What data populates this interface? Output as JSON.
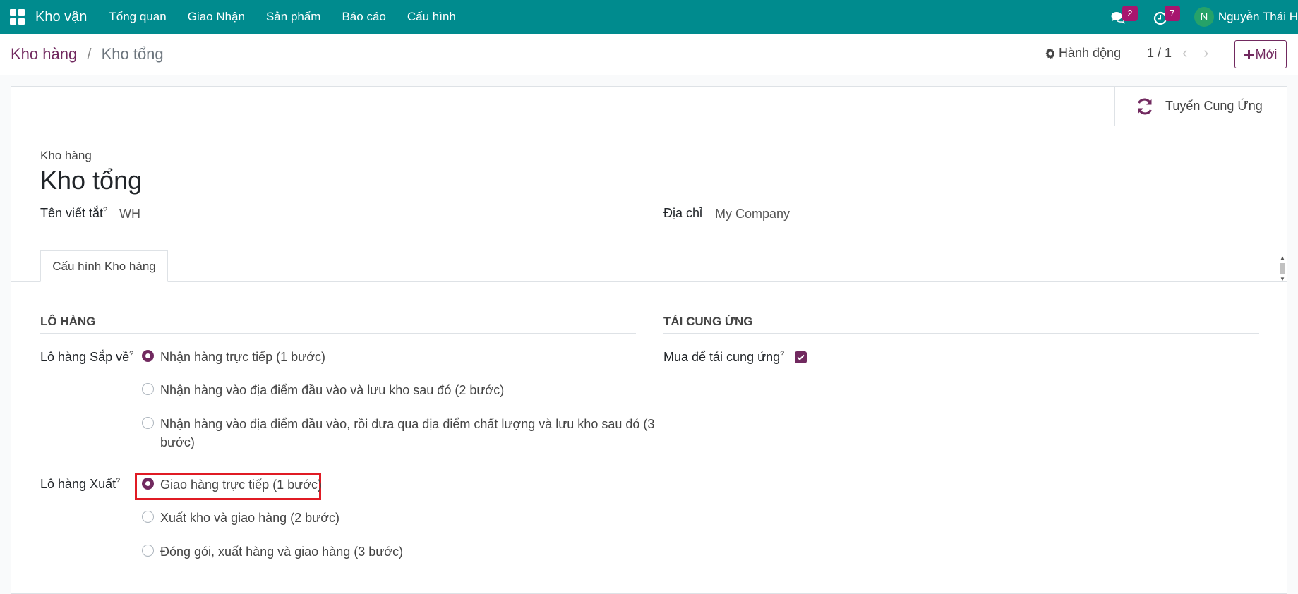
{
  "navbar": {
    "app_name": "Kho vận",
    "menu": [
      "Tổng quan",
      "Giao Nhận",
      "Sản phẩm",
      "Báo cáo",
      "Cấu hình"
    ],
    "messages_count": "2",
    "activities_count": "7",
    "avatar_initial": "N",
    "username": "Nguyễn Thái H",
    "bg_color": "#008b8e"
  },
  "control": {
    "breadcrumb_parent": "Kho hàng",
    "breadcrumb_sep": "/",
    "breadcrumb_current": "Kho tổng",
    "action_label": "Hành động",
    "pager": "1 / 1",
    "new_label": "Mới"
  },
  "smart_button": {
    "label": "Tuyến Cung Ứng"
  },
  "form": {
    "top_label": "Kho hàng",
    "title": "Kho tổng",
    "short_name_label": "Tên viết tắt",
    "short_name_value": "WH",
    "address_label": "Địa chỉ",
    "address_value": "My Company",
    "tab_label": "Cấu hình Kho hàng",
    "help_mark": "?"
  },
  "shipments": {
    "section_title": "LÔ HÀNG",
    "incoming_label": "Lô hàng Sắp về",
    "incoming_options": [
      "Nhận hàng trực tiếp (1 bước)",
      "Nhận hàng vào địa điểm đầu vào và lưu kho sau đó (2 bước)",
      "Nhận hàng vào địa điểm đầu vào, rồi đưa qua địa điểm chất lượng và lưu kho sau đó (3",
      "bước)"
    ],
    "outgoing_label": "Lô hàng Xuất",
    "outgoing_options": [
      "Giao hàng trực tiếp (1 bước)",
      "Xuất kho và giao hàng (2 bước)",
      "Đóng gói, xuất hàng và giao hàng (3 bước)"
    ]
  },
  "resupply": {
    "section_title": "TÁI CUNG ỨNG",
    "buy_label": "Mua để tái cung ứng",
    "buy_checked": true
  },
  "colors": {
    "accent": "#71295f",
    "highlight": "#e01b24"
  }
}
